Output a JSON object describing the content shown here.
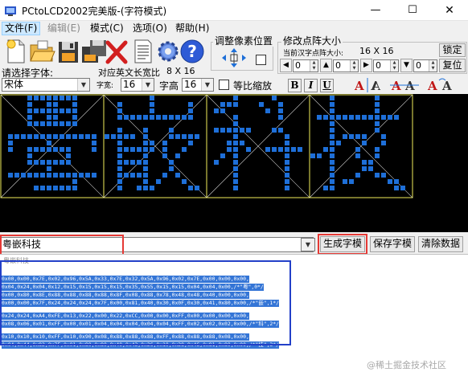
{
  "window": {
    "title": "PCtoLCD2002完美版-(字符模式)",
    "minimize_glyph": "—",
    "maximize_glyph": "☐",
    "close_glyph": "✕"
  },
  "menu": [
    {
      "label": "文件(F)",
      "state": "active"
    },
    {
      "label": "编辑(E)",
      "state": "disabled"
    },
    {
      "label": "模式(C)",
      "state": "normal"
    },
    {
      "label": "选项(O)",
      "state": "normal"
    },
    {
      "label": "帮助(H)",
      "state": "normal"
    }
  ],
  "font_panel": {
    "label": "请选择字体:",
    "font_value": "宋体",
    "char_width_label": "字宽:",
    "char_width_value": "16",
    "char_height_label": "字高",
    "char_height_value": "16",
    "proportional_label": "等比缩放",
    "bold_label": "B",
    "italic_label": "I",
    "underline_label": "U",
    "ascii_width_label": "对应英文长宽比",
    "ascii_size": "8 X 16"
  },
  "pixel_adjust": {
    "title": "调整像素位置"
  },
  "matrix_size": {
    "title": "修改点阵大小",
    "current_label": "当前汉字点阵大小:",
    "current_value": "16 X 16",
    "lock_label": "锁定",
    "restore_label": "复位",
    "spin_values": [
      "0",
      "0",
      "0",
      "0"
    ]
  },
  "glyphs": [
    [
      "0000111111110000",
      "0000100110010000",
      "0000111111110000",
      "0000100110010000",
      "0000111111110000",
      "0000000000000000",
      "0111111111111110",
      "0100000100000010",
      "0100111111100010",
      "0000100000100000",
      "0000111111100000",
      "0000000100000000",
      "0111111111111110",
      "0000000000010000",
      "0000011111110000",
      "0000000000000000"
    ],
    [
      "0000000100000000",
      "0010000100000100",
      "0010000100000100",
      "0011111111111100",
      "0000000000000000",
      "0010001000100000",
      "1111101000111110",
      "0010001101000100",
      "0011111101001000",
      "0010001001010000",
      "0011111000100000",
      "0010001000100000",
      "0011111001010000",
      "0010001010001000",
      "0010011100000110",
      "0000000000000000"
    ],
    [
      "0000100000100000",
      "0011100010010000",
      "0110000001010000",
      "0000100000010000",
      "0000100000000000",
      "0111111000110000",
      "0000100000001000",
      "0001110000001000",
      "0001101001111110",
      "0010100000001000",
      "0100100000001000",
      "0000100000001000",
      "0000100000001000",
      "0000100000001000",
      "0000100000001000",
      "0000000000000000"
    ],
    [
      "0001000000100000",
      "0001000000100000",
      "0001000000100000",
      "0111111111111100",
      "0001000000100000",
      "0001000000100000",
      "0001011110010000",
      "0001100010010000",
      "0011000100100000",
      "1101000100100000",
      "0001000011000000",
      "0001000011000000",
      "0001000100110000",
      "0001011000001100",
      "0011000000000110",
      "0000000000000000"
    ]
  ],
  "input": {
    "text": "粤嵌科技"
  },
  "actions": {
    "generate": "生成字模",
    "save": "保存字模",
    "clear": "清除数据"
  },
  "output": {
    "header": "粤嵌科技",
    "lines": [
      "0x00,0x00,0x7E,0x02,0x96,0x5A,0x33,0x7E,0x32,0x5A,0x96,0x02,0x7E,0x00,0x00,0x00,",
      "0x04,0x24,0x04,0x12,0x15,0x15,0x15,0x15,0x35,0x55,0x15,0x15,0x04,0x04,0x00,/*\"粤\",0*/",
      "0x00,0x80,0x8E,0x88,0x88,0x88,0x88,0x8F,0x08,0x88,0x78,0x48,0x48,0x40,0x00,0x00,",
      "0x00,0x00,0x7F,0x24,0x24,0x24,0x7F,0x00,0x81,0x40,0x30,0x0F,0x30,0x41,0x80,0x00,/*\"嵌\",1*/",
      "0x24,0x24,0xA4,0xFE,0x13,0x22,0x00,0x22,0xCC,0x00,0x00,0xFF,0x00,0x00,0x00,0x00,",
      "0x08,0x06,0x01,0xFF,0x00,0x01,0x04,0x04,0x04,0x04,0x04,0xFF,0x02,0x02,0x02,0x00,/*\"科\",2*/",
      "0x10,0x10,0x10,0xFF,0x10,0x90,0x08,0x88,0x88,0x88,0xFF,0x88,0x88,0x88,0x08,0x00,",
      "0x04,0x44,0x82,0x7F,0x01,0x80,0x80,0x40,0x43,0x2C,0x10,0x28,0x46,0x81,0x80,0x00,/*\"技\",3*/"
    ]
  },
  "watermark": "@稀土掘金技术社区",
  "colors": {
    "pixel_on": "#1e6fd8",
    "grid_line": "#f2ee5a",
    "canvas_bg": "#000000",
    "highlight_red": "#e53935",
    "highlight_blue": "#2340c8",
    "selection_bg": "#3475d6"
  }
}
